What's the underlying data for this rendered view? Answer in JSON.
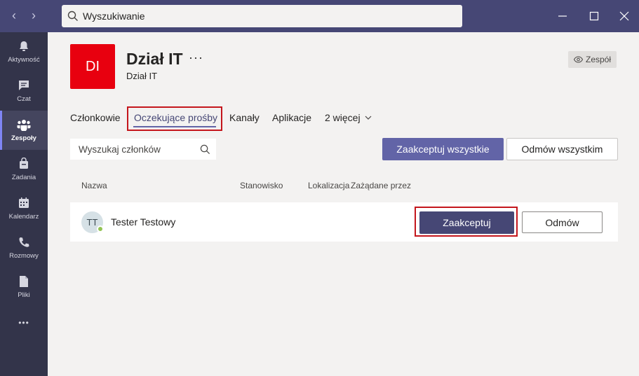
{
  "search": {
    "placeholder": "Wyszukiwanie"
  },
  "rail": {
    "items": [
      {
        "label": "Aktywność",
        "icon": "bell-icon"
      },
      {
        "label": "Czat",
        "icon": "chat-icon"
      },
      {
        "label": "Zespoły",
        "icon": "teams-icon"
      },
      {
        "label": "Zadania",
        "icon": "assignments-icon"
      },
      {
        "label": "Kalendarz",
        "icon": "calendar-icon"
      },
      {
        "label": "Rozmowy",
        "icon": "phone-icon"
      },
      {
        "label": "Pliki",
        "icon": "file-icon"
      }
    ],
    "more": "•••"
  },
  "team": {
    "avatar": "DI",
    "name": "Dział IT",
    "more": "···",
    "subtitle": "Dział IT",
    "badge": "Zespół",
    "avatar_color": "#e8000f"
  },
  "tabs": [
    {
      "label": "Członkowie"
    },
    {
      "label": "Oczekujące prośby"
    },
    {
      "label": "Kanały"
    },
    {
      "label": "Aplikacje"
    },
    {
      "label": "2 więcej"
    }
  ],
  "filter": {
    "search_placeholder": "Wyszukaj członków",
    "accept_all": "Zaakceptuj wszystkie",
    "reject_all": "Odmów wszystkim"
  },
  "table": {
    "columns": [
      "Nazwa",
      "Stanowisko",
      "Lokalizacja",
      "Zażądane przez"
    ],
    "rows": [
      {
        "initials": "TT",
        "name": "Tester Testowy",
        "accept": "Zaakceptuj",
        "reject": "Odmów"
      }
    ]
  },
  "colors": {
    "accent": "#6264a7",
    "titlebar": "#464775",
    "rail": "#33344a",
    "highlight": "#c4161c"
  }
}
